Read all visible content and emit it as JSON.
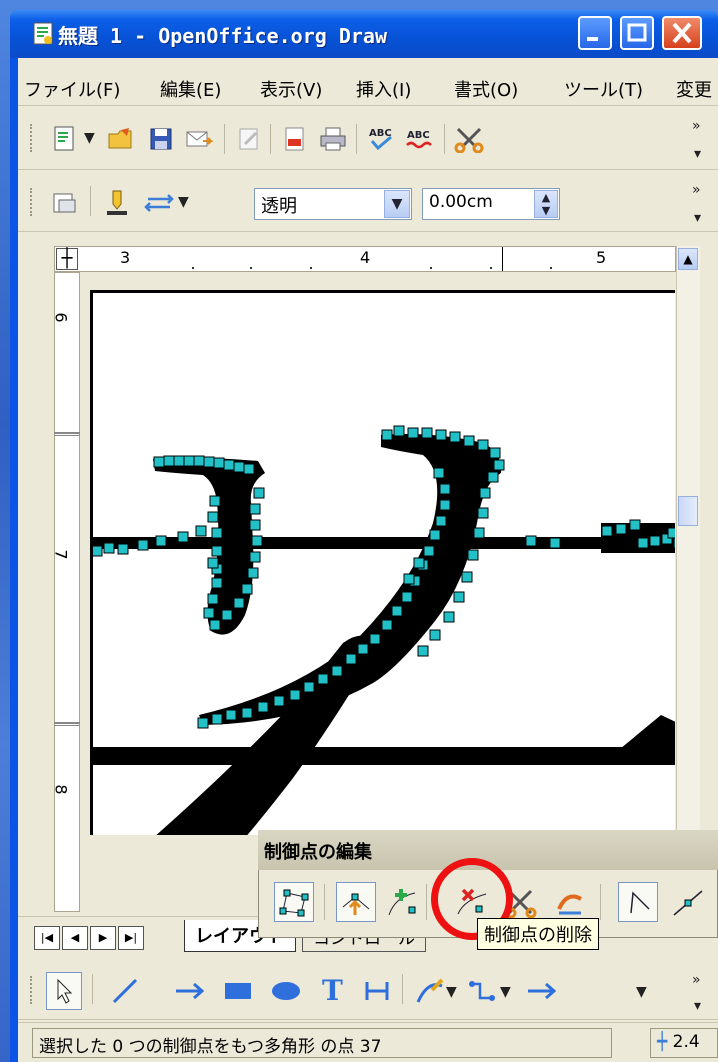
{
  "window": {
    "title": "無題 1 - OpenOffice.org Draw"
  },
  "menu": [
    "ファイル(F)",
    "編集(E)",
    "表示(V)",
    "挿入(I)",
    "書式(O)",
    "ツール(T)",
    "変更"
  ],
  "toolbar2": {
    "fill_value": "透明",
    "line_width": "0.00cm"
  },
  "ruler": {
    "top_marks": [
      "3",
      "4",
      "5"
    ],
    "left_marks": [
      "6",
      "7",
      "8"
    ]
  },
  "tabs": [
    "レイアウト",
    "コントロール"
  ],
  "point_toolbar": {
    "title": "制御点の編集",
    "tooltip": "制御点の削除"
  },
  "status": {
    "message": "選択した 0 つの制御点をもつ多角形 の点 37",
    "coord": "2.4"
  },
  "colors": {
    "titlebar": "#0a55e6",
    "window_face": "#ece9d8",
    "handle": "#22c1c8",
    "highlight_ring": "#ee1111"
  }
}
